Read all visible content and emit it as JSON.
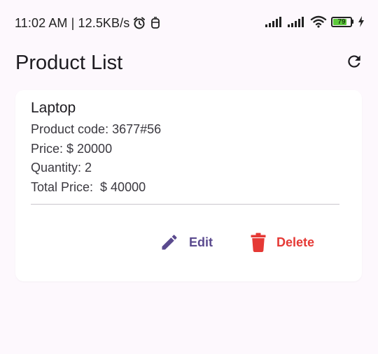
{
  "status_bar": {
    "time_speed": "11:02 AM | 12.5KB/s",
    "alarm_icon": "alarm-icon",
    "extra_icon": "notification-icon",
    "battery_level": "79",
    "battery_fraction": 0.79,
    "charging_icon": "bolt-icon"
  },
  "appbar": {
    "title": "Product List",
    "refresh_icon": "refresh-icon"
  },
  "product": {
    "name": "Laptop",
    "code_line": "Product code: 3677#56",
    "price_line": "Price: $ 20000",
    "quantity_line": "Quantity: 2",
    "total_line": "Total Price:  $ 40000"
  },
  "actions": {
    "edit_label": "Edit",
    "delete_label": "Delete",
    "edit_icon": "pencil-icon",
    "delete_icon": "trash-icon"
  },
  "colors": {
    "background": "#fdf8fd",
    "card": "#ffffff",
    "edit": "#5a4a8e",
    "delete": "#e53935",
    "battery": "#5cc93a"
  }
}
